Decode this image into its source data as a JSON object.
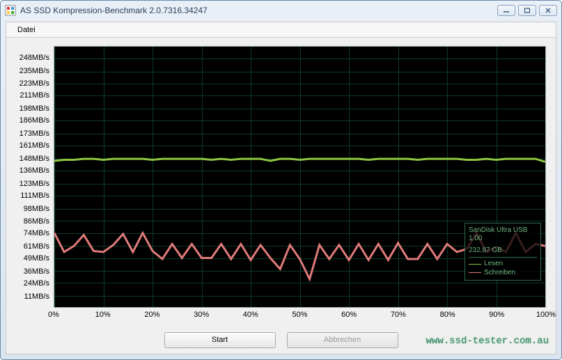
{
  "window": {
    "title": "AS SSD Kompression-Benchmark 2.0.7316.34247"
  },
  "menu": {
    "file": "Datei"
  },
  "buttons": {
    "start": "Start",
    "abort": "Abbrechen"
  },
  "legend": {
    "device": "SanDisk Ultra USB",
    "version": "1.00",
    "capacity": "232,87 GB",
    "read": "Lesen",
    "write": "Schreiben",
    "read_color": "#8cc63f",
    "write_color": "#e07a7a"
  },
  "watermark": "www.ssd-tester.com.au",
  "chart_data": {
    "type": "line",
    "xlabel": "",
    "ylabel": "",
    "ylim": [
      0,
      260
    ],
    "xlim": [
      0,
      100
    ],
    "y_ticks": [
      11,
      24,
      36,
      49,
      61,
      74,
      86,
      98,
      111,
      123,
      136,
      148,
      161,
      173,
      186,
      198,
      211,
      223,
      235,
      248
    ],
    "y_tick_labels": [
      "11MB/s",
      "24MB/s",
      "36MB/s",
      "49MB/s",
      "61MB/s",
      "74MB/s",
      "86MB/s",
      "98MB/s",
      "111MB/s",
      "123MB/s",
      "136MB/s",
      "148MB/s",
      "161MB/s",
      "173MB/s",
      "186MB/s",
      "198MB/s",
      "211MB/s",
      "223MB/s",
      "235MB/s",
      "248MB/s"
    ],
    "x_ticks": [
      0,
      10,
      20,
      30,
      40,
      50,
      60,
      70,
      80,
      90,
      100
    ],
    "x_tick_labels": [
      "0%",
      "10%",
      "20%",
      "30%",
      "40%",
      "50%",
      "60%",
      "70%",
      "80%",
      "90%",
      "100%"
    ],
    "x": [
      0,
      2,
      4,
      6,
      8,
      10,
      12,
      14,
      16,
      18,
      20,
      22,
      24,
      26,
      28,
      30,
      32,
      34,
      36,
      38,
      40,
      42,
      44,
      46,
      48,
      50,
      52,
      54,
      56,
      58,
      60,
      62,
      64,
      66,
      68,
      70,
      72,
      74,
      76,
      78,
      80,
      82,
      84,
      86,
      88,
      90,
      92,
      94,
      96,
      98,
      100
    ],
    "series": [
      {
        "name": "Lesen",
        "color": "#8cc63f",
        "values": [
          146,
          147,
          147,
          148,
          148,
          147,
          148,
          148,
          148,
          148,
          147,
          148,
          148,
          148,
          148,
          148,
          147,
          148,
          147,
          148,
          148,
          148,
          146,
          148,
          148,
          147,
          148,
          148,
          148,
          148,
          148,
          148,
          147,
          148,
          148,
          148,
          148,
          147,
          148,
          148,
          148,
          148,
          147,
          147,
          148,
          147,
          148,
          148,
          148,
          148,
          145
        ]
      },
      {
        "name": "Schreiben",
        "color": "#e07a7a",
        "values": [
          74,
          55,
          61,
          72,
          56,
          55,
          62,
          73,
          55,
          74,
          56,
          48,
          63,
          49,
          63,
          49,
          49,
          63,
          48,
          63,
          47,
          62,
          49,
          38,
          62,
          48,
          28,
          62,
          48,
          62,
          47,
          63,
          47,
          63,
          47,
          64,
          48,
          48,
          63,
          48,
          63,
          55,
          58,
          74,
          55,
          60,
          55,
          74,
          55,
          63,
          61
        ]
      }
    ]
  }
}
